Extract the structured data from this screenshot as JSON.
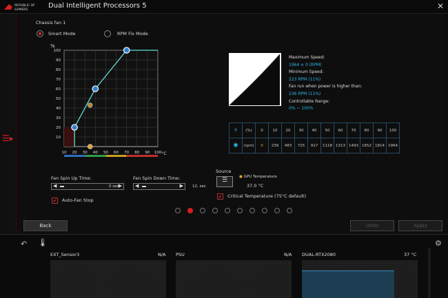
{
  "app": {
    "logo_text": "REPUBLIC OF GAMERS",
    "title": "Dual Intelligent Processors 5"
  },
  "fan": {
    "name": "Chassis fan 1",
    "mode_smart": "Smart Mode",
    "mode_rpm": "RPM Fix Mode",
    "smart_selected": true
  },
  "chart_data": {
    "type": "line",
    "ylabel": "%",
    "xlabel": "°C",
    "x_ticks": [
      "10",
      "20",
      "30",
      "40",
      "50",
      "60",
      "70",
      "80",
      "90",
      "100"
    ],
    "y_ticks": [
      "10",
      "20",
      "30",
      "40",
      "50",
      "60",
      "70",
      "80",
      "90",
      "100"
    ],
    "xlim": [
      10,
      100
    ],
    "ylim": [
      0,
      100
    ],
    "points": [
      {
        "x": 20,
        "y": 20
      },
      {
        "x": 40,
        "y": 60
      },
      {
        "x": 70,
        "y": 100
      }
    ],
    "extra_points": [
      {
        "x": 35,
        "y": 43
      },
      {
        "x": 35,
        "y": 0
      }
    ],
    "line_end": [
      100,
      100
    ]
  },
  "stats": {
    "max_speed_label": "Maximum Speed:",
    "max_speed": "1964 ± 0 (RPM)",
    "min_speed_label": "Minimum Speed:",
    "min_speed": "223 RPM (11%)",
    "fan_run_label": "Fan run when power is higher than:",
    "fan_run": "236 RPM (11%)",
    "range_label": "Controllable Range:",
    "range": "0% ~ 100%"
  },
  "rpm_table": {
    "percent_unit": "(%)",
    "rpm_unit": "(rpm)",
    "percents": [
      "0",
      "10",
      "20",
      "30",
      "40",
      "50",
      "60",
      "70",
      "80",
      "90",
      "100"
    ],
    "rpms": [
      "0",
      "239",
      "483",
      "725",
      "917",
      "1118",
      "1313",
      "1493",
      "1652",
      "1814",
      "1964"
    ]
  },
  "controls": {
    "spin_up_label": "Fan Spin Up Time:",
    "spin_up_value": "0 sec",
    "spin_down_label": "Fan Spin Down Time:",
    "spin_down_value": "12, sec",
    "source_label": "Source",
    "source_name": "GPU Temperature",
    "source_temp": "37.0 °C",
    "auto_stop_label": "Auto-Fan Stop",
    "critical_label": "Critical Temperature (75°C default)"
  },
  "buttons": {
    "back": "Back",
    "undo": "Undo",
    "apply": "Apply"
  },
  "pages": {
    "count": 10,
    "active": 1
  },
  "sensors": [
    {
      "name": "EXT_Sensor3",
      "value": "N/A"
    },
    {
      "name": "PSU",
      "value": "N/A"
    },
    {
      "name": "DUAL-RTX2080",
      "value": "37 °C"
    }
  ],
  "colors": {
    "accent": "#e03030",
    "cyan": "#2fb7e8"
  }
}
